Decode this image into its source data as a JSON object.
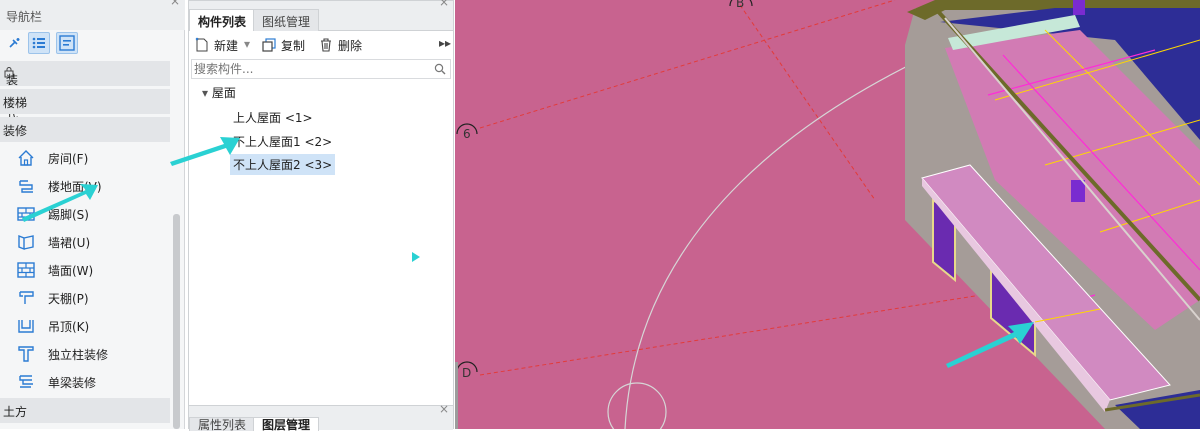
{
  "nav": {
    "title": "导航栏",
    "close_glyph": "×",
    "toolbar": [
      {
        "icon": "sparkle-icon"
      },
      {
        "icon": "list-view-icon",
        "selected": true
      },
      {
        "icon": "detail-view-icon",
        "selected": true
      }
    ],
    "categories": {
      "prefab": "装配式",
      "stairs": "楼梯",
      "decoration": "装修",
      "earthwork": "土方"
    },
    "items": [
      {
        "label": "房间(F)",
        "icon": "house-icon"
      },
      {
        "label": "楼地面(V)",
        "icon": "floor-icon"
      },
      {
        "label": "踢脚(S)",
        "icon": "baseboard-icon"
      },
      {
        "label": "墙裙(U)",
        "icon": "dado-icon"
      },
      {
        "label": "墙面(W)",
        "icon": "wall-surface-icon"
      },
      {
        "label": "天棚(P)",
        "icon": "ceiling-icon"
      },
      {
        "label": "吊顶(K)",
        "icon": "suspended-ceiling-icon"
      },
      {
        "label": "独立柱装修",
        "icon": "column-finish-icon"
      },
      {
        "label": "单梁装修",
        "icon": "beam-finish-icon"
      }
    ]
  },
  "component_panel": {
    "tabs": [
      "构件列表",
      "图纸管理"
    ],
    "toolbar": {
      "new_label": "新建",
      "copy_label": "复制",
      "delete_label": "删除",
      "more_glyph": "▸▸"
    },
    "search_placeholder": "搜索构件...",
    "tree": {
      "group": "屋面",
      "children": [
        "上人屋面 <1>",
        "不上人屋面1 <2>",
        "不上人屋面2 <3>"
      ],
      "selected_index": 2
    },
    "bottom_tabs": [
      "属性列表",
      "图层管理"
    ]
  },
  "viewport": {
    "axis_labels": {
      "b": "B",
      "six": "6",
      "d": "D"
    },
    "colors": {
      "floor": "#c8638f",
      "wall": "#a59c98",
      "parapet_cap": "#d9d2ce",
      "roof_blue": "#2d2d96",
      "window_purple": "#6a2bb0",
      "canopy": "#d18ac1",
      "grid_yellow": "#ffd700",
      "grid_magenta": "#ff2bd8"
    }
  },
  "annotations": {
    "arrow_color": "#2ad1d3"
  }
}
